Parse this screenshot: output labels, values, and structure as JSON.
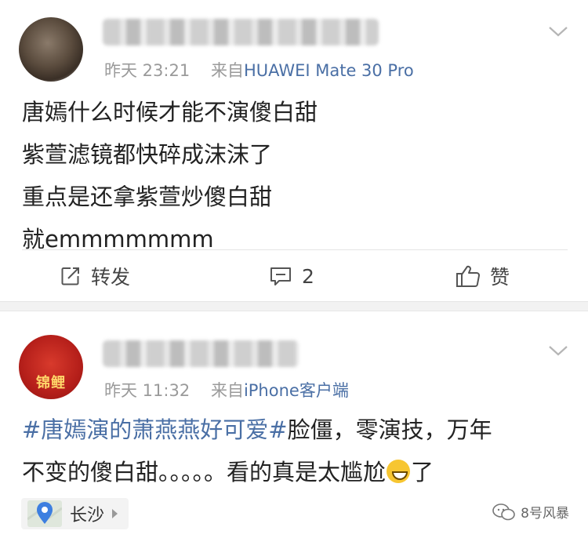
{
  "posts": [
    {
      "meta": {
        "time": "昨天 23:21",
        "source_prefix": "来自",
        "source": "HUAWEI Mate 30 Pro"
      },
      "content_lines": [
        "唐嫣什么时候才能不演傻白甜",
        "紫萱滤镜都快碎成沫沫了",
        "重点是还拿紫萱炒傻白甜",
        "就emmmmmmm"
      ],
      "actions": {
        "repost_label": "转发",
        "comment_count": "2",
        "like_label": "赞"
      }
    },
    {
      "meta": {
        "time": "昨天 11:32",
        "source_prefix": "来自",
        "source": "iPhone客户端"
      },
      "avatar_text": "锦鲤",
      "content": {
        "topic": "#唐嫣演的萧燕燕好可爱#",
        "line1_rest": "脸僵，零演技，万年",
        "line2": "不变的傻白甜。。。。。看的真是太尴尬",
        "line2_end": "了"
      },
      "location": "长沙",
      "watermark": "8号风暴"
    }
  ],
  "colors": {
    "link_blue": "#4a6fa5",
    "meta_gray": "#9a9a9a",
    "separator": "#f2f2f2"
  }
}
